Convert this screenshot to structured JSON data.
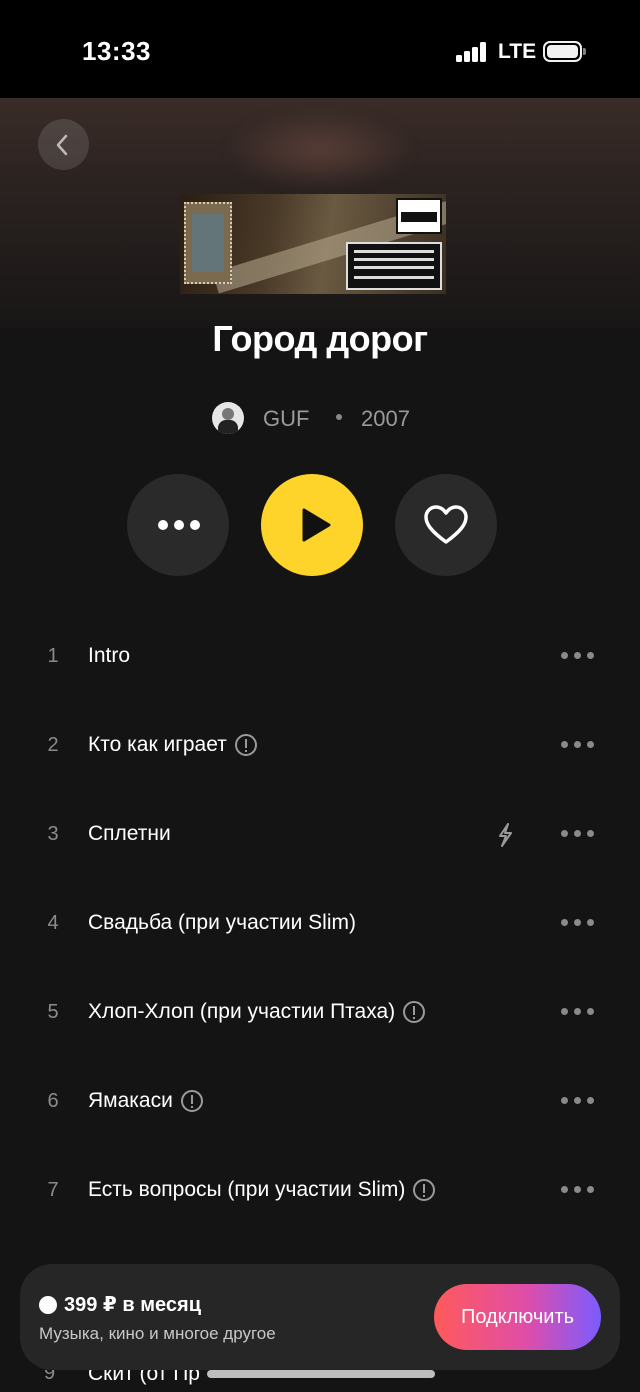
{
  "status_bar": {
    "time": "13:33",
    "network": "LTE"
  },
  "album": {
    "title": "Город дорог",
    "artist": "GUF",
    "year": "2007"
  },
  "tracks": [
    {
      "num": "1",
      "title": "Intro",
      "explicit": false,
      "bolt": false
    },
    {
      "num": "2",
      "title": "Кто как играет",
      "explicit": true,
      "bolt": false
    },
    {
      "num": "3",
      "title": "Сплетни",
      "explicit": false,
      "bolt": true
    },
    {
      "num": "4",
      "title": "Свадьба (при участии Slim)",
      "explicit": false,
      "bolt": false
    },
    {
      "num": "5",
      "title": "Хлоп-Хлоп (при участии Птаха)",
      "explicit": true,
      "bolt": false
    },
    {
      "num": "6",
      "title": "Ямакаси",
      "explicit": true,
      "bolt": false
    },
    {
      "num": "7",
      "title": "Есть вопросы (при участии Slim)",
      "explicit": true,
      "bolt": false
    }
  ],
  "partial_track": {
    "num": "9",
    "title": "Скит (от Пр"
  },
  "promo": {
    "price": "399 ₽ в месяц",
    "subtitle": "Музыка, кино и многое другое",
    "button_label": "Подключить"
  },
  "colors": {
    "accent": "#fed42b",
    "background": "#141414"
  }
}
